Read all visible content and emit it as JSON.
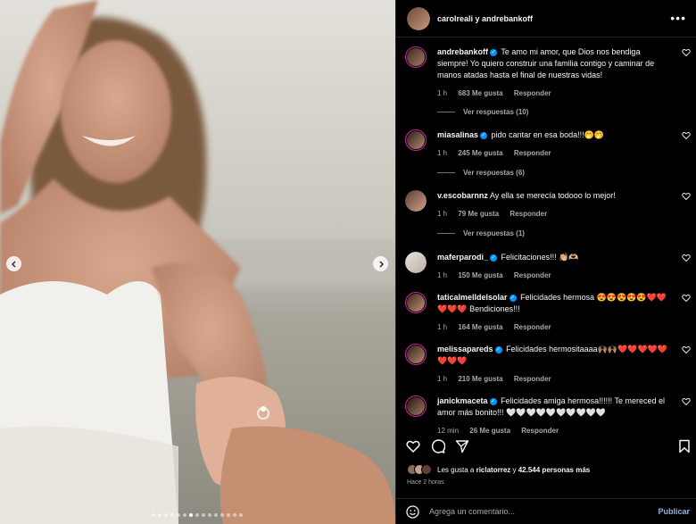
{
  "header": {
    "names": "carolreali y andrebankoff"
  },
  "comments": [
    {
      "user": "andrebankoff",
      "verified": true,
      "text": "Te amo mi amor, que Dios nos bendiga siempre! Yo quiero construir una familia contigo y caminar de manos atadas hasta el final de nuestras vidas!",
      "time": "1 h",
      "likes": "683 Me gusta",
      "reply": "Responder",
      "view_replies": "Ver respuestas (10)"
    },
    {
      "user": "miasalinas",
      "verified": true,
      "text": "pido cantar en esa boda!!!🤭🤭",
      "time": "1 h",
      "likes": "245 Me gusta",
      "reply": "Responder",
      "view_replies": "Ver respuestas (6)"
    },
    {
      "user": "v.escobarnnz",
      "verified": false,
      "text": "Ay ella se merecía todooo lo mejor!",
      "time": "1 h",
      "likes": "79 Me gusta",
      "reply": "Responder",
      "view_replies": "Ver respuestas (1)"
    },
    {
      "user": "maferparodi_",
      "verified": true,
      "text": "Felicitaciones!!! 👏🏼🫶🏼",
      "time": "1 h",
      "likes": "150 Me gusta",
      "reply": "Responder"
    },
    {
      "user": "taticalmelldelsolar",
      "verified": true,
      "text": "Felicidades hermosa 😍😍😍😍😍❤️❤️❤️❤️❤️ Bendiciones!!!",
      "time": "1 h",
      "likes": "164 Me gusta",
      "reply": "Responder"
    },
    {
      "user": "melissapareds",
      "verified": true,
      "text": "Felicidades hermositaaaa🙌🏽🙌🏽❤️❤️❤️❤️❤️❤️❤️❤️",
      "time": "1 h",
      "likes": "210 Me gusta",
      "reply": "Responder"
    },
    {
      "user": "janickmaceta",
      "verified": true,
      "text": "Felicidades amiga hermosa!!!!!! Te mereced el amor más bonito!!! 🤍🤍🤍🤍🤍🤍🤍🤍🤍🤍",
      "time": "12 min",
      "likes": "26 Me gusta",
      "reply": "Responder"
    }
  ],
  "likes_summary": {
    "prefix": "Les gusta a ",
    "user": "riclatorrez",
    "middle": " y ",
    "count": "42.544 personas más"
  },
  "time_ago": "Hace 2 horas",
  "add_comment": {
    "placeholder": "Agrega un comentario...",
    "publish": "Publicar"
  },
  "colors": {
    "accent": "#0095f6",
    "ring": "#d6249f",
    "muted": "#a8a8a8"
  },
  "carousel": {
    "total": 15,
    "active": 7
  }
}
